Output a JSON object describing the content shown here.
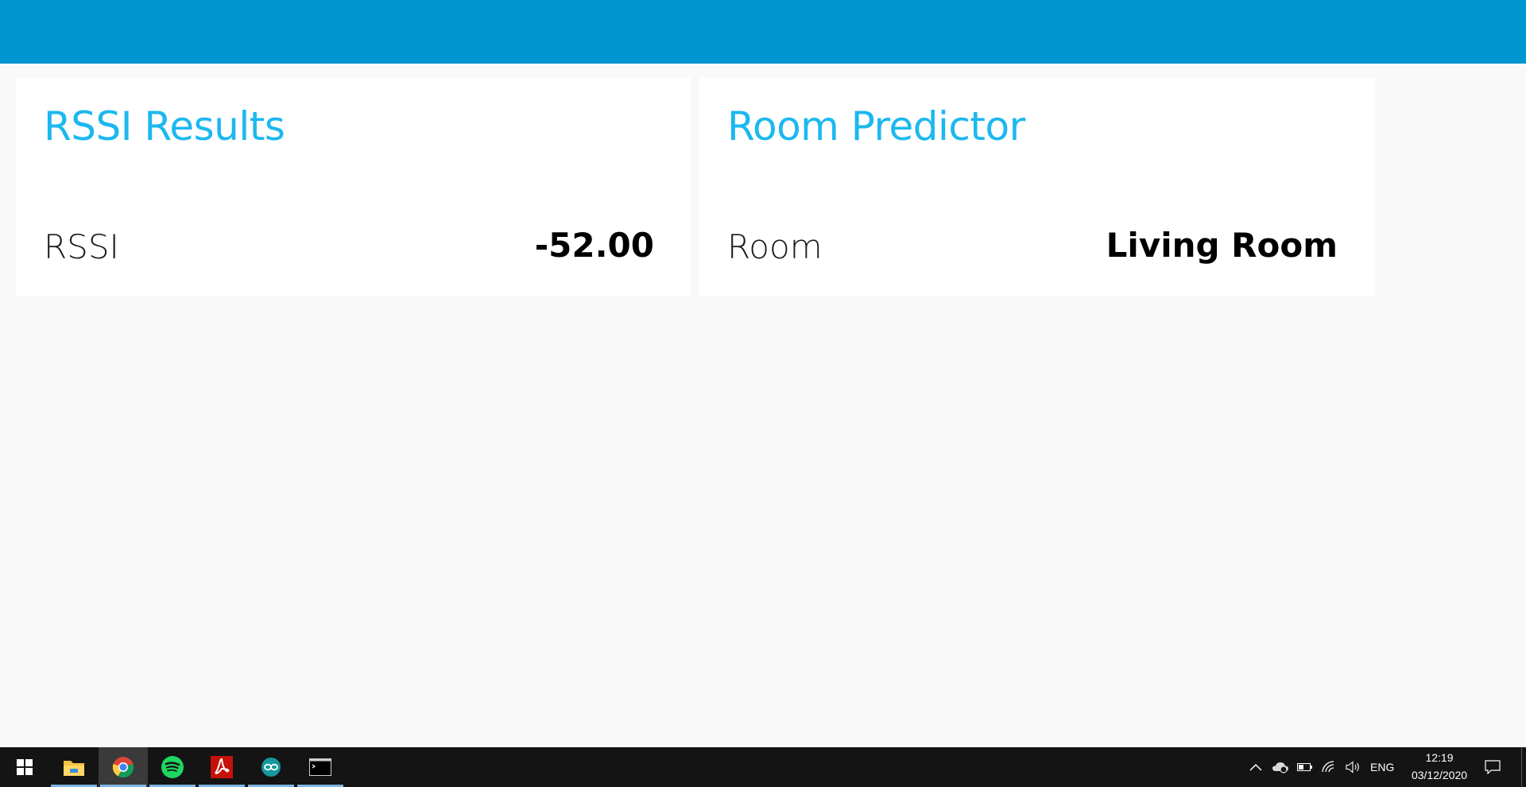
{
  "header": {
    "color": "#0094d0"
  },
  "cards": [
    {
      "title": "RSSI Results",
      "metric_label": "RSSI",
      "metric_value": "-52.00"
    },
    {
      "title": "Room Predictor",
      "metric_label": "Room",
      "metric_value": "Living Room"
    }
  ],
  "taskbar": {
    "apps": [
      {
        "icon": "windows-start-icon",
        "active": false
      },
      {
        "icon": "file-explorer-icon",
        "active": false
      },
      {
        "icon": "chrome-icon",
        "active": true
      },
      {
        "icon": "spotify-icon",
        "active": false
      },
      {
        "icon": "acrobat-icon",
        "active": false
      },
      {
        "icon": "arduino-icon",
        "active": false
      },
      {
        "icon": "terminal-icon",
        "active": false
      }
    ],
    "language": "ENG",
    "time": "12:19",
    "date": "03/12/2020"
  },
  "colors": {
    "accent": "#1cb8ef",
    "header": "#0094d0",
    "background": "#f9f9f9"
  }
}
